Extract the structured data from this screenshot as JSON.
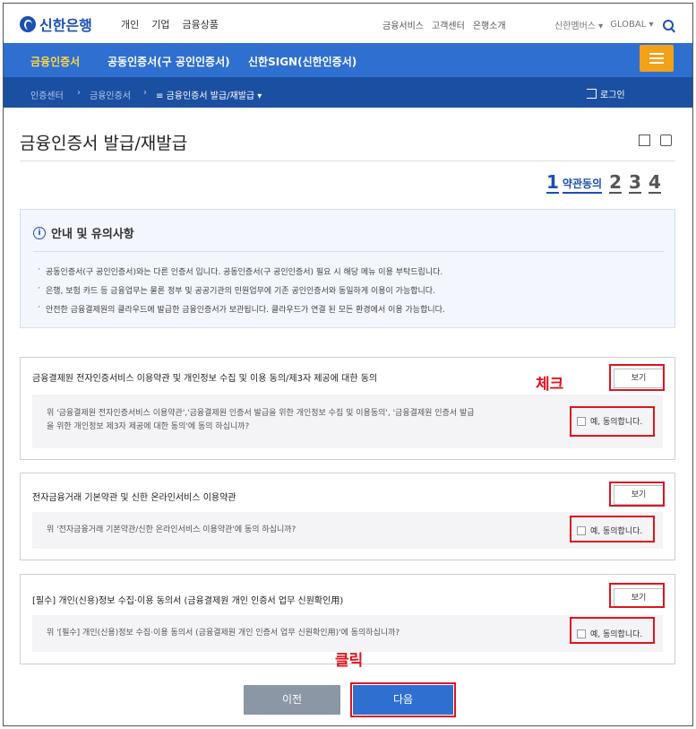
{
  "brand": {
    "name": "신한은행"
  },
  "header": {
    "main_nav": [
      "개인",
      "기업",
      "금융상품"
    ],
    "util_nav": [
      "금융서비스",
      "고객센터",
      "은행소개"
    ],
    "family_site": "신한멤버스 ▾",
    "global": "GLOBAL ▾"
  },
  "blue_nav": {
    "tabs": [
      "금융인증서",
      "공동인증서(구 공인인증서)",
      "신한SIGN(신한인증서)"
    ]
  },
  "breadcrumb": {
    "items": [
      "인증센터",
      "금융인증서"
    ],
    "current": "≡ 금융인증서 발급/재발급 ▾",
    "login": "로그인"
  },
  "page": {
    "title": "금융인증서 발급/재발급"
  },
  "steps": {
    "current_num": "1",
    "current_label": "약관동의",
    "others": [
      "2",
      "3",
      "4"
    ]
  },
  "notice": {
    "title": "안내 및 유의사항",
    "items": [
      "공동인증서(구 공인인증서)와는 다른 인증서 입니다. 공동인증서(구 공인인증서) 필요 시 해당 메뉴 이용 부탁드립니다.",
      "은행, 보험 카드 등 금융업무는 물론 정부 및 공공기관의 민원업무에 기존 공인인증서와 동일하게 이용이 가능합니다.",
      "안전한 금융결제원의 클라우드에 발급한 금융인증서가 보관됩니다. 클라우드가 연결 된 모든 환경에서 이용 가능합니다."
    ]
  },
  "agreements": [
    {
      "title": "금융결제원 전자인증서비스 이용약관 및 개인정보 수집 및 이용 동의/제3자 제공에 대한 동의",
      "question_line1": "위 '금융결제원 전자인증서비스 이용약관','금융결제원 인증서 발급을 위한 개인정보 수집 및 이용동의', '금융결제원 인증서 발급",
      "question_line2": "을 위한 개인정보 제3자 제공에 대한 동의'에 동의 하십니까?",
      "view_label": "보기",
      "agree_label": "예, 동의합니다."
    },
    {
      "title": "전자금융거래 기본약관 및 신한 온라인서비스 이용약관",
      "question_line1": "위 '전자금융거래 기본약관/신한 온라인서비스 이용약관'에 동의 하십니까?",
      "question_line2": "",
      "view_label": "보기",
      "agree_label": "예, 동의합니다."
    },
    {
      "title": "[필수] 개인(신용)정보 수집·이용 동의서 (금융결제원 개인 인증서 업무 신원확인用)",
      "question_line1": "위 '[필수] 개인(신용)정보 수집·이용 동의서 (금융결제원 개인 인증서 업무 신원확인用)'에 동의하십니까?",
      "question_line2": "",
      "view_label": "보기",
      "agree_label": "예, 동의합니다."
    }
  ],
  "annotations": {
    "check": "체크",
    "click": "클릭"
  },
  "buttons": {
    "prev": "이전",
    "next": "다음"
  },
  "colors": {
    "brand_blue": "#2f6fd0",
    "dark_blue": "#1b4fa2",
    "accent_orange": "#f2a11b",
    "annotation_red": "#e0141e"
  }
}
